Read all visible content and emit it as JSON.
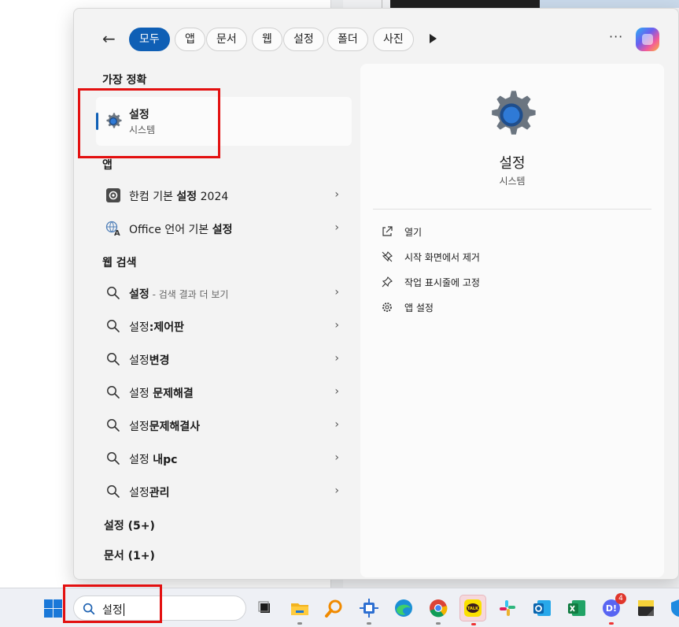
{
  "filters": {
    "back_label": "←",
    "chips": [
      "모두",
      "앱",
      "문서",
      "웹",
      "설정",
      "폴더",
      "사진"
    ],
    "active_index": 0,
    "more_label": "···"
  },
  "left": {
    "best_match_heading": "가장 정확",
    "best_match": {
      "title": "설정",
      "subtitle": "시스템"
    },
    "apps_heading": "앱",
    "apps": [
      {
        "prefix": "한컴 기본 ",
        "bold": "설정",
        "suffix": " 2024",
        "icon": "hancom-settings-icon"
      },
      {
        "prefix": "Office 언어 기본 ",
        "bold": "설정",
        "suffix": "",
        "icon": "office-language-icon"
      }
    ],
    "web_heading": "웹 검색",
    "web": [
      {
        "prefix": "",
        "bold": "설정",
        "suffix": "",
        "hint": " - 검색 결과 더 보기"
      },
      {
        "prefix": "설정",
        "bold": ":제어판",
        "suffix": "",
        "hint": ""
      },
      {
        "prefix": "설정",
        "bold": "변경",
        "suffix": "",
        "hint": ""
      },
      {
        "prefix": "설정 ",
        "bold": "문제해결",
        "suffix": "",
        "hint": ""
      },
      {
        "prefix": "설정",
        "bold": "문제해결사",
        "suffix": "",
        "hint": ""
      },
      {
        "prefix": "설정 ",
        "bold": "내pc",
        "suffix": "",
        "hint": ""
      },
      {
        "prefix": "설정",
        "bold": "관리",
        "suffix": "",
        "hint": ""
      }
    ],
    "settings_group": "설정 (5+)",
    "documents_group": "문서 (1+)"
  },
  "detail": {
    "title": "설정",
    "subtitle": "시스템",
    "actions": [
      {
        "label": "열기",
        "icon": "open-external-icon"
      },
      {
        "label": "시작 화면에서 제거",
        "icon": "unpin-icon"
      },
      {
        "label": "작업 표시줄에 고정",
        "icon": "pin-icon"
      },
      {
        "label": "앱 설정",
        "icon": "gear-icon"
      }
    ]
  },
  "taskbar": {
    "search_text": "설정",
    "notification_badge": "4",
    "apps": [
      "task-view",
      "file-explorer",
      "search-app",
      "network-app",
      "edge",
      "chrome",
      "kakaotalk",
      "slack",
      "outlook",
      "excel",
      "discord",
      "sticky-notes",
      "security"
    ]
  },
  "colors": {
    "accent": "#0f5fb5",
    "highlight_box": "#e31010"
  }
}
